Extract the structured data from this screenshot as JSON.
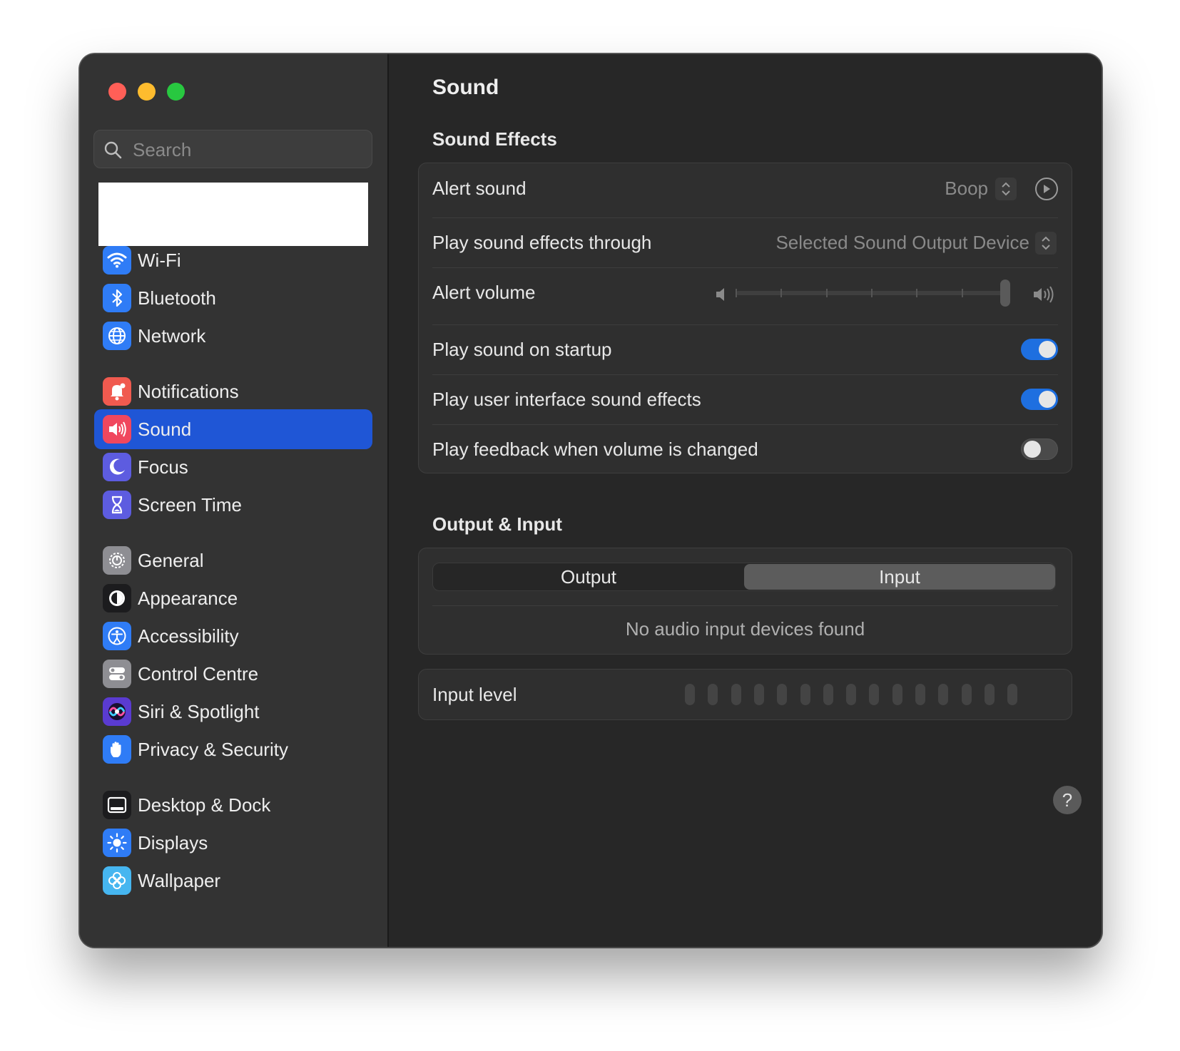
{
  "window": {
    "title": "Sound"
  },
  "sidebar": {
    "search_placeholder": "Search",
    "items": [
      {
        "label": "Wi-Fi",
        "icon": "wifi-icon",
        "color": "#2f7cf6"
      },
      {
        "label": "Bluetooth",
        "icon": "bluetooth-icon",
        "color": "#2f7cf6"
      },
      {
        "label": "Network",
        "icon": "globe-icon",
        "color": "#2f7cf6"
      },
      {
        "label": "Notifications",
        "icon": "bell-icon",
        "color": "#f05a4f"
      },
      {
        "label": "Sound",
        "icon": "speaker-icon",
        "color": "#f0475e",
        "selected": true
      },
      {
        "label": "Focus",
        "icon": "moon-icon",
        "color": "#5d5ce0"
      },
      {
        "label": "Screen Time",
        "icon": "hourglass-icon",
        "color": "#5d5ce0"
      },
      {
        "label": "General",
        "icon": "gear-icon",
        "color": "#8e8e93"
      },
      {
        "label": "Appearance",
        "icon": "appearance-icon",
        "color": "#1c1c1e"
      },
      {
        "label": "Accessibility",
        "icon": "accessibility-icon",
        "color": "#2f7cf6"
      },
      {
        "label": "Control Centre",
        "icon": "control-centre-icon",
        "color": "#8e8e93"
      },
      {
        "label": "Siri & Spotlight",
        "icon": "siri-icon",
        "color": "#5a3bd1"
      },
      {
        "label": "Privacy & Security",
        "icon": "hand-icon",
        "color": "#2f7cf6"
      },
      {
        "label": "Desktop & Dock",
        "icon": "dock-icon",
        "color": "#1c1c1e"
      },
      {
        "label": "Displays",
        "icon": "sun-icon",
        "color": "#2f7cf6"
      },
      {
        "label": "Wallpaper",
        "icon": "flower-icon",
        "color": "#46b6f0"
      }
    ]
  },
  "sound_effects": {
    "heading": "Sound Effects",
    "alert_sound_label": "Alert sound",
    "alert_sound_value": "Boop",
    "play_through_label": "Play sound effects through",
    "play_through_value": "Selected Sound Output Device",
    "alert_volume_label": "Alert volume",
    "alert_volume_level": 1.0,
    "startup_label": "Play sound on startup",
    "startup_on": true,
    "ui_effects_label": "Play user interface sound effects",
    "ui_effects_on": true,
    "feedback_label": "Play feedback when volume is changed",
    "feedback_on": false
  },
  "output_input": {
    "heading": "Output & Input",
    "tabs": [
      "Output",
      "Input"
    ],
    "active_tab": "Input",
    "empty_message": "No audio input devices found",
    "input_level_label": "Input level",
    "input_level_segments": 15,
    "input_level_active": 0
  },
  "help_label": "?",
  "colors": {
    "accent": "#1f56d6",
    "toggle_on": "#1e6fe0"
  }
}
